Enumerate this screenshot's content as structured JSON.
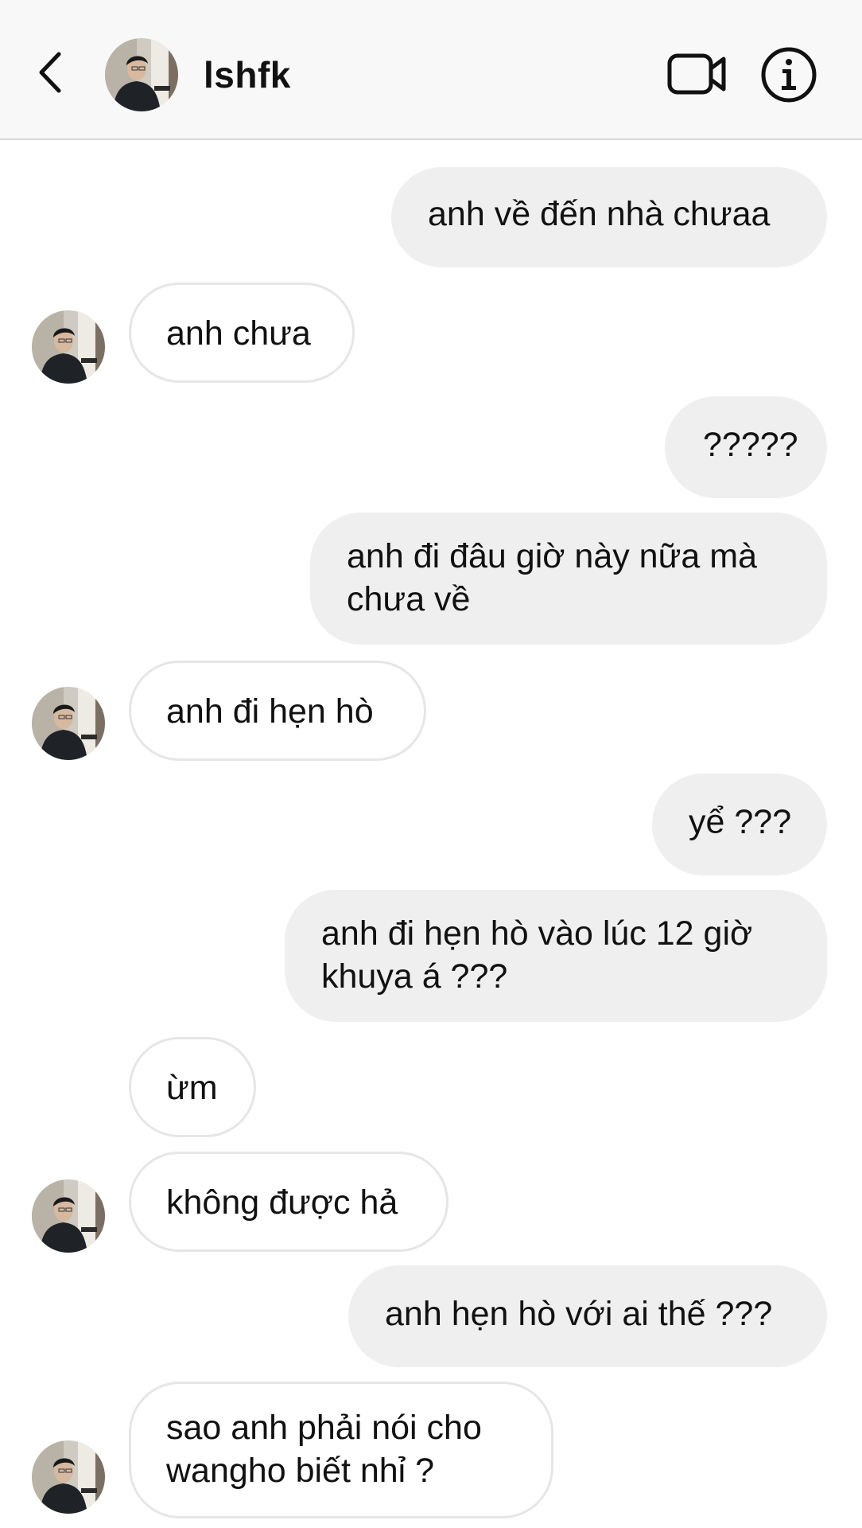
{
  "header": {
    "username": "lshfk",
    "back_icon": "chevron-left-icon",
    "video_icon": "video-camera-icon",
    "info_icon": "info-icon"
  },
  "messages": [
    {
      "from": "me",
      "text": "anh về đến nhà chưaa"
    },
    {
      "from": "them",
      "text": "anh chưa"
    },
    {
      "from": "me",
      "text": "?????"
    },
    {
      "from": "me",
      "text": "anh đi đâu giờ này nữa mà\nchưa về"
    },
    {
      "from": "them",
      "text": "anh đi hẹn hò"
    },
    {
      "from": "me",
      "text": "yể ???"
    },
    {
      "from": "me",
      "text": "anh đi hẹn hò vào lúc 12 giờ\nkhuya á ???"
    },
    {
      "from": "them",
      "text": "ừm"
    },
    {
      "from": "them",
      "text": "không được hả"
    },
    {
      "from": "me",
      "text": "anh hẹn hò với ai thế ???"
    },
    {
      "from": "them",
      "text": "sao anh phải nói cho\nwangho biết nhỉ ?"
    }
  ],
  "colors": {
    "outgoing_bubble": "#efefef",
    "incoming_border": "#e6e6e6",
    "header_bg": "#f8f8f8"
  }
}
